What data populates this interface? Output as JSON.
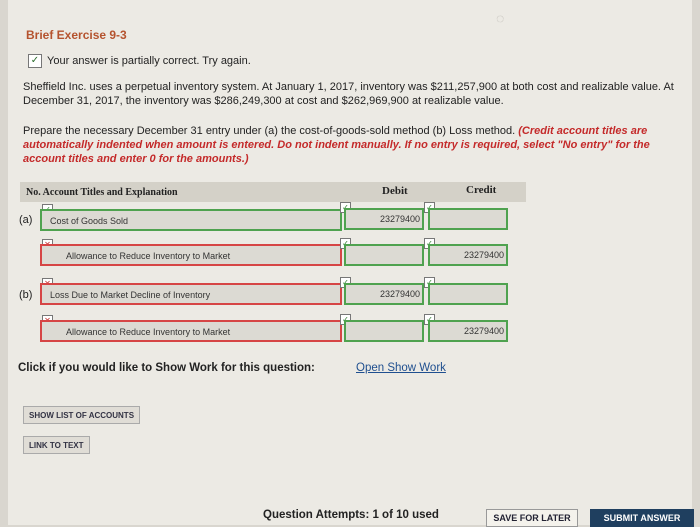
{
  "title": "Brief Exercise 9-3",
  "status": {
    "text": "Your answer is partially correct.  Try again."
  },
  "problem_text": "Sheffield Inc. uses a perpetual inventory system. At January 1, 2017, inventory was $211,257,900 at both cost and realizable value. At December 31, 2017, the inventory was $286,249,300 at cost and $262,969,900 at realizable value.",
  "instructions": {
    "plain": "Prepare the necessary December 31 entry under (a) the cost-of-goods-sold method (b) Loss method. ",
    "red": "(Credit account titles are automatically indented when amount is entered. Do not indent manually. If no entry is required, select \"No entry\" for the account titles and enter 0 for the amounts.)"
  },
  "table": {
    "headers": {
      "account": "No.  Account Titles and Explanation",
      "debit": "Debit",
      "credit": "Credit"
    },
    "rows": [
      {
        "label": "(a)",
        "account": "Cost of Goods Sold",
        "debit": "23279400",
        "credit": ""
      },
      {
        "label": "",
        "account": "Allowance to Reduce Inventory to Market",
        "debit": "",
        "credit": "23279400"
      },
      {
        "label": "(b)",
        "account": "Loss Due to Market Decline of Inventory",
        "debit": "23279400",
        "credit": ""
      },
      {
        "label": "",
        "account": "Allowance to Reduce Inventory to Market",
        "debit": "",
        "credit": "23279400"
      }
    ]
  },
  "show_work": {
    "prompt": "Click if you would like to Show Work for this question:",
    "link": "Open Show Work"
  },
  "buttons": {
    "list_accounts": "SHOW LIST OF ACCOUNTS",
    "link_text": "LINK TO TEXT",
    "save": "SAVE FOR LATER",
    "submit": "SUBMIT ANSWER"
  },
  "attempts": "Question Attempts: 1 of 10 used",
  "marks": {
    "correct": "✓",
    "incorrect": "✕"
  },
  "colors": {
    "correct": "#4fa24f",
    "incorrect": "#d64545",
    "title": "#b5532e",
    "submit_bg": "#1f3f5f"
  }
}
